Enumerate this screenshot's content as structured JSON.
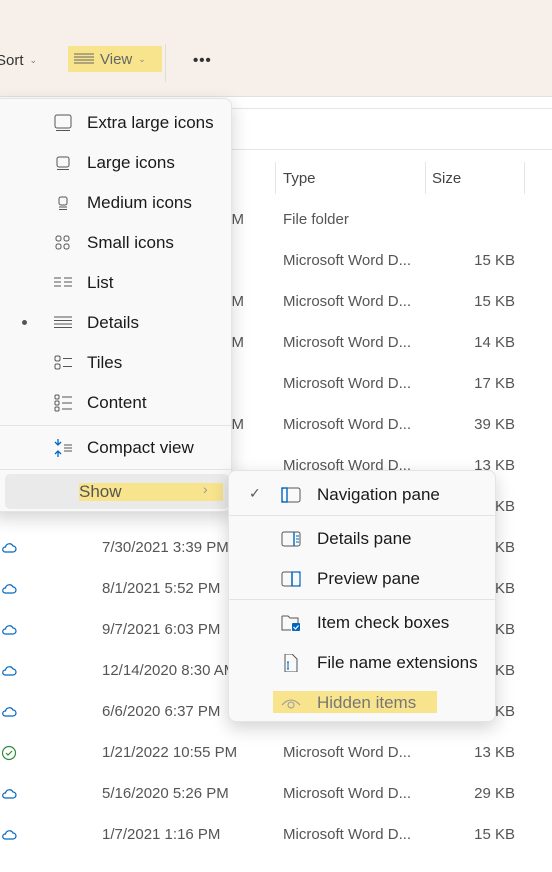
{
  "toolbar": {
    "sort_label": "Sort",
    "view_label": "View",
    "more_label": "•••"
  },
  "columns": {
    "type": "Type",
    "size": "Size"
  },
  "rows": [
    {
      "date": "M",
      "type": "File folder",
      "size": "",
      "status": ""
    },
    {
      "date": "",
      "type": "Microsoft Word D...",
      "size": "15 KB",
      "status": ""
    },
    {
      "date": "M",
      "type": "Microsoft Word D...",
      "size": "15 KB",
      "status": ""
    },
    {
      "date": "M",
      "type": "Microsoft Word D...",
      "size": "14 KB",
      "status": ""
    },
    {
      "date": "",
      "type": "Microsoft Word D...",
      "size": "17 KB",
      "status": ""
    },
    {
      "date": "M",
      "type": "Microsoft Word D...",
      "size": "39 KB",
      "status": ""
    },
    {
      "date": "",
      "type": "Microsoft Word D...",
      "size": "13 KB",
      "status": ""
    },
    {
      "date": "",
      "type": "",
      "size": "KB",
      "status": ""
    },
    {
      "date": "7/30/2021 3:39 PM",
      "type": "",
      "size": "KB",
      "status": "cloud"
    },
    {
      "date": "8/1/2021 5:52 PM",
      "type": "",
      "size": "KB",
      "status": "cloud"
    },
    {
      "date": "9/7/2021 6:03 PM",
      "type": "",
      "size": "KB",
      "status": "cloud"
    },
    {
      "date": "12/14/2020 8:30 AM",
      "type": "",
      "size": "KB",
      "status": "cloud"
    },
    {
      "date": "6/6/2020 6:37 PM",
      "type": "",
      "size": "KB",
      "status": "cloud"
    },
    {
      "date": "1/21/2022 10:55 PM",
      "type": "Microsoft Word D...",
      "size": "13 KB",
      "status": "check"
    },
    {
      "date": "5/16/2020 5:26 PM",
      "type": "Microsoft Word D...",
      "size": "29 KB",
      "status": "cloud"
    },
    {
      "date": "1/7/2021 1:16 PM",
      "type": "Microsoft Word D...",
      "size": "15 KB",
      "status": "cloud"
    }
  ],
  "view_menu": {
    "items": [
      {
        "label": "Extra large icons",
        "icon": "extra-large-icons-icon"
      },
      {
        "label": "Large icons",
        "icon": "large-icons-icon"
      },
      {
        "label": "Medium icons",
        "icon": "medium-icons-icon"
      },
      {
        "label": "Small icons",
        "icon": "small-icons-icon"
      },
      {
        "label": "List",
        "icon": "list-icon"
      },
      {
        "label": "Details",
        "icon": "details-icon",
        "selected": true
      },
      {
        "label": "Tiles",
        "icon": "tiles-icon"
      },
      {
        "label": "Content",
        "icon": "content-icon"
      }
    ],
    "compact": "Compact view",
    "show": "Show"
  },
  "show_menu": {
    "navigation": "Navigation pane",
    "details": "Details pane",
    "preview": "Preview pane",
    "checkboxes": "Item check boxes",
    "extensions": "File name extensions",
    "hidden": "Hidden items"
  },
  "colors": {
    "highlight": "#f8e48c",
    "accent": "#0067c0",
    "sync_ok": "#2e8b3a"
  }
}
